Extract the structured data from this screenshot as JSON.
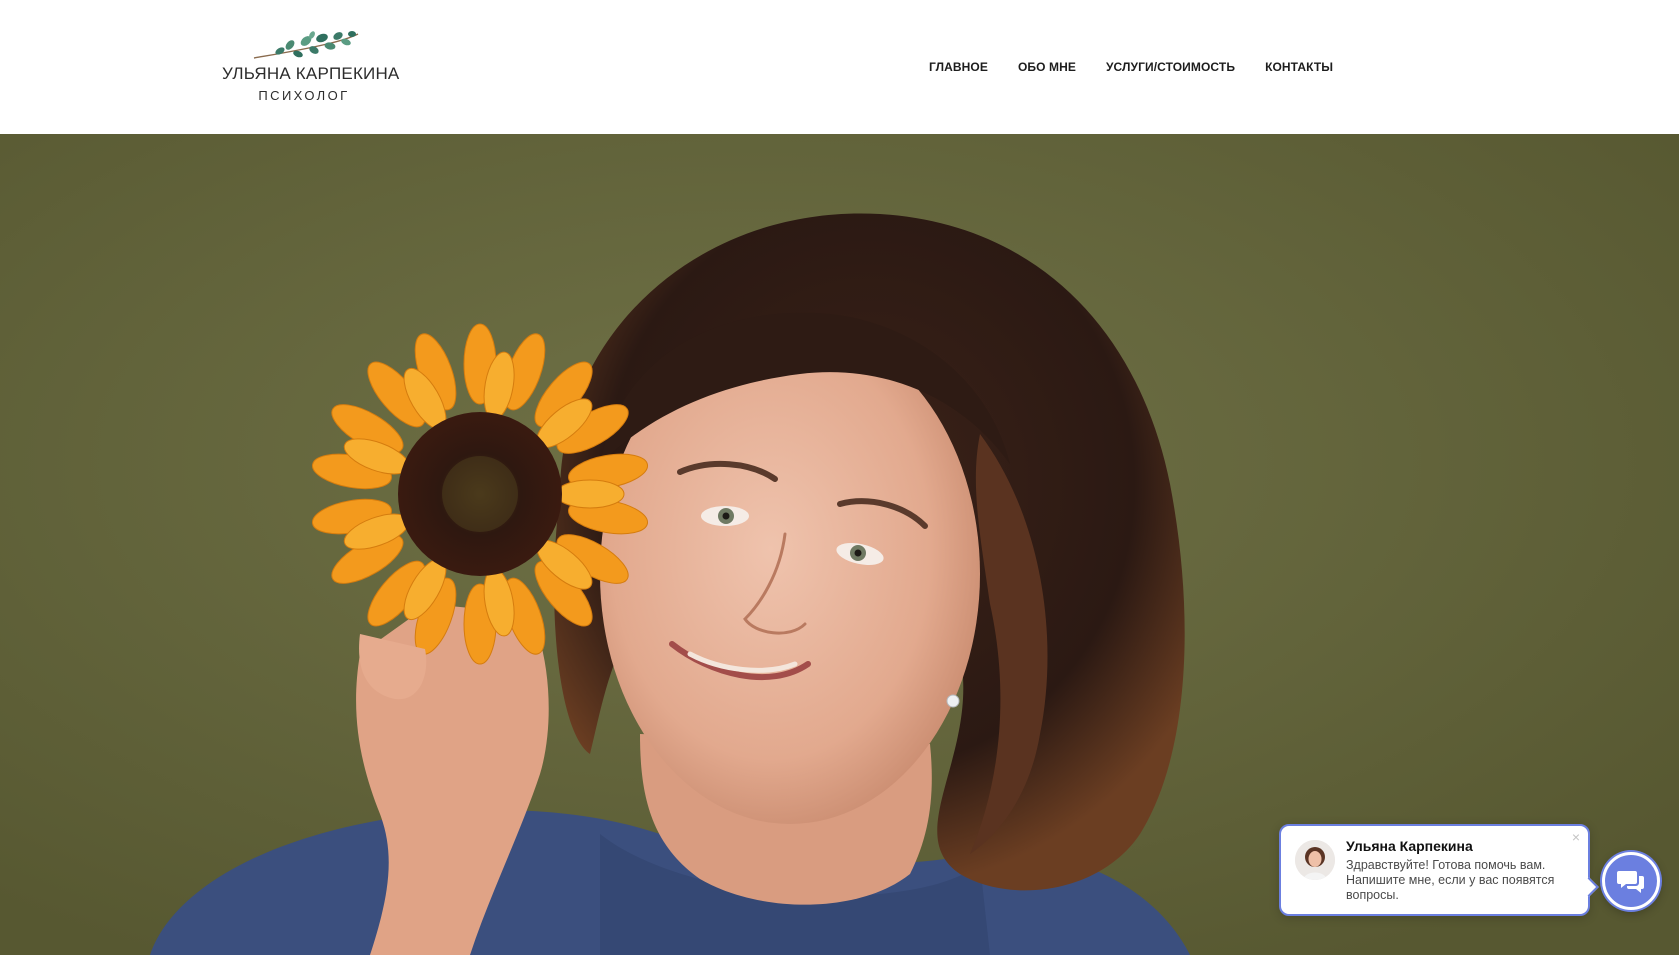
{
  "header": {
    "logo": {
      "name": "УЛЬЯНА КАРПЕКИНА",
      "role": "ПСИХОЛОГ",
      "icon": "eucalyptus-branch-icon"
    },
    "nav": [
      {
        "label": "ГЛАВНОЕ"
      },
      {
        "label": "ОБО МНЕ"
      },
      {
        "label": "УСЛУГИ/СТОИМОСТЬ"
      },
      {
        "label": "КОНТАКТЫ"
      }
    ]
  },
  "hero": {
    "image": "portrait-woman-with-sunflower"
  },
  "chat_widget": {
    "name": "Ульяна Карпекина",
    "message": "Здравствуйте! Готова помочь вам. Напишите мне, если у вас появятся вопросы.",
    "close_symbol": "×",
    "launcher_icon": "chat-bubbles-icon"
  },
  "colors": {
    "accent": "#6b7fe0",
    "hero_background": "#63653c",
    "sweater": "#3b4f7e",
    "sunflower": "#f39a1d"
  }
}
